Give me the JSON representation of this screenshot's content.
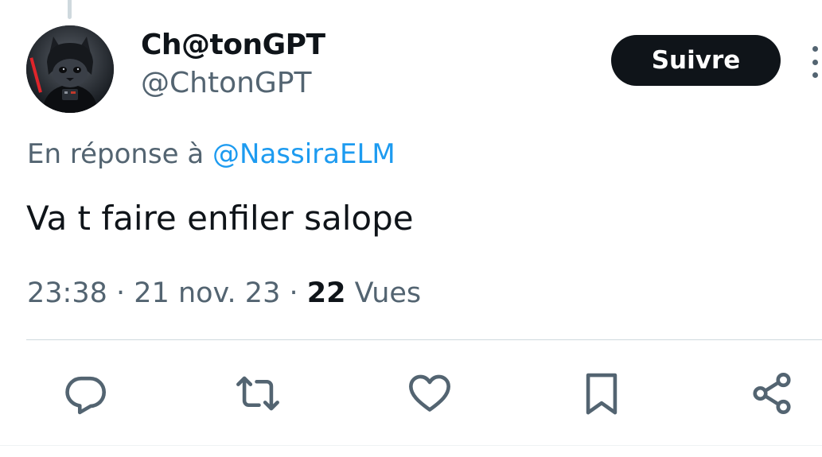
{
  "colors": {
    "text_primary": "#0f1419",
    "text_secondary": "#536471",
    "link": "#1d9bf0",
    "button_bg": "#0f1419",
    "divider": "#cfd9de"
  },
  "author": {
    "display_name": "Ch@tonGPT",
    "handle": "@ChtonGPT",
    "avatar_icon": "darth-vader-cat-avatar"
  },
  "follow_button": {
    "label": "Suivre"
  },
  "more_menu": {
    "icon": "more-vertical-icon"
  },
  "reply": {
    "prefix": "En réponse à",
    "to": "@NassiraELM"
  },
  "tweet": {
    "text": "Va t faire enfiler salope"
  },
  "meta": {
    "time": "23:38",
    "separator": "·",
    "date": "21 nov. 23",
    "views_count": "22",
    "views_label": "Vues"
  },
  "actions": [
    {
      "icon": "reply-icon"
    },
    {
      "icon": "retweet-icon"
    },
    {
      "icon": "like-icon"
    },
    {
      "icon": "bookmark-icon"
    },
    {
      "icon": "share-icon"
    }
  ]
}
